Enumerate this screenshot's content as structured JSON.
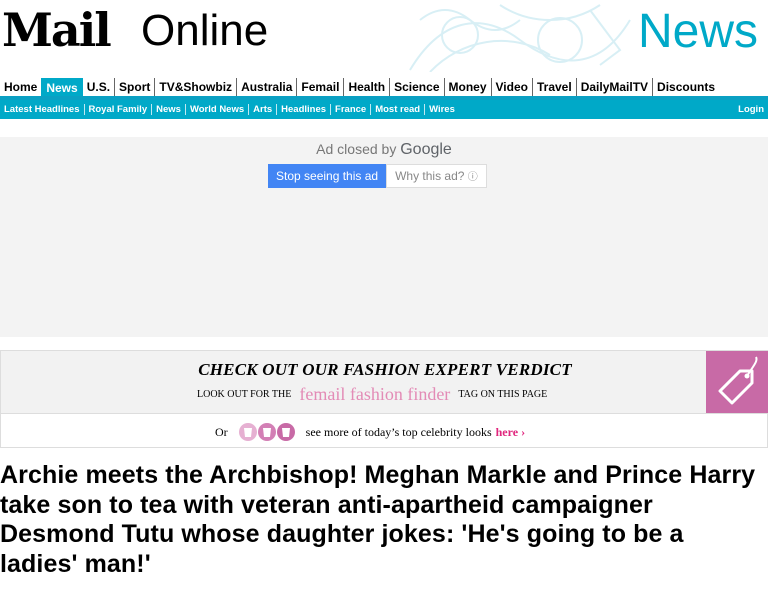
{
  "masthead": {
    "logo_mail": "Mail",
    "logo_online": "Online",
    "section": "News"
  },
  "nav": {
    "items": [
      "Home",
      "News",
      "U.S.",
      "Sport",
      "TV&Showbiz",
      "Australia",
      "Femail",
      "Health",
      "Science",
      "Money",
      "Video",
      "Travel",
      "DailyMailTV",
      "Discounts"
    ],
    "active": "News"
  },
  "subnav": {
    "items": [
      "Latest Headlines",
      "Royal Family",
      "News",
      "World News",
      "Arts",
      "Headlines",
      "France",
      "Most read",
      "Wires"
    ],
    "login": "Login"
  },
  "ad": {
    "closed_text": "Ad closed by",
    "brand": "Google",
    "stop_label": "Stop seeing this ad",
    "why_label": "Why this ad?"
  },
  "fashion": {
    "heading": "CHECK OUT OUR FASHION EXPERT VERDICT",
    "look_out": "LOOK OUT FOR THE",
    "finder": "femail fashion finder",
    "tag_text": "TAG ON THIS PAGE",
    "or": "Or",
    "see_more": "see more of today’s top celebrity looks",
    "here": "here"
  },
  "article": {
    "headline": "Archie meets the Archbishop! Meghan Markle and Prince Harry take son to tea with veteran anti-apartheid campaigner Desmond Tutu whose daughter jokes: 'He's going to be a ladies' man!'"
  },
  "colors": {
    "accent": "#00a9c8",
    "google_blue": "#4285f4",
    "fashion_pink": "#c86aa6"
  }
}
